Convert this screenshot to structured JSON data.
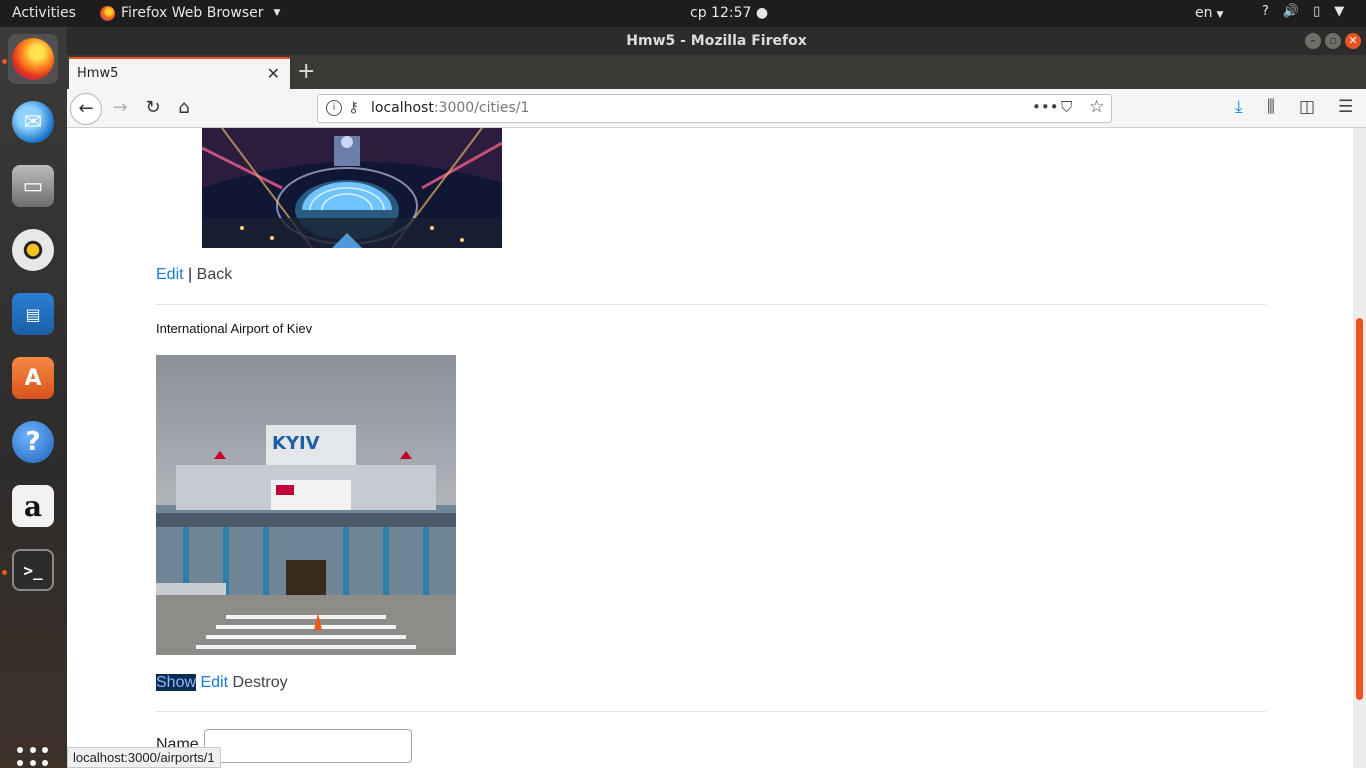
{
  "topbar": {
    "activities": "Activities",
    "app_menu": "Firefox Web Browser",
    "clock": "ср 12:57 ●",
    "language": "en"
  },
  "window": {
    "title": "Hmw5 - Mozilla Firefox"
  },
  "tabs": [
    {
      "title": "Hmw5"
    }
  ],
  "urlbar": {
    "host": "localhost",
    "rest": ":3000/cities/1"
  },
  "page": {
    "city_links": {
      "edit": "Edit",
      "separator": "|",
      "back": "Back"
    },
    "airport": {
      "name": "International Airport of Kiev",
      "sign_text": "KYIV",
      "links": {
        "show": "Show",
        "edit": "Edit",
        "destroy": "Destroy"
      }
    },
    "form": {
      "name_label": "Name"
    }
  },
  "status_bar": {
    "url": "localhost:3000/airports/1"
  },
  "dock": [
    {
      "name": "firefox-icon"
    },
    {
      "name": "thunderbird-icon"
    },
    {
      "name": "files-icon"
    },
    {
      "name": "rhythmbox-icon"
    },
    {
      "name": "libreoffice-writer-icon"
    },
    {
      "name": "software-store-icon"
    },
    {
      "name": "help-icon"
    },
    {
      "name": "amazon-icon"
    },
    {
      "name": "terminal-icon"
    }
  ],
  "colors": {
    "accent": "#e95420",
    "link": "#1a7ad6"
  }
}
